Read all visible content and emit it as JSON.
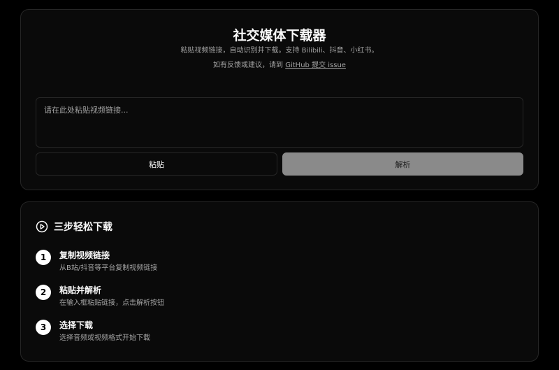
{
  "header": {
    "title": "社交媒体下载器",
    "subtitle": "粘贴视频链接，自动识别并下载。支持 Bilibili、抖音、小红书。",
    "feedback_prefix": "如有反馈或建议，请到",
    "feedback_link": "GitHub 提交 issue"
  },
  "input": {
    "placeholder": "请在此处粘贴视频链接...",
    "value": ""
  },
  "buttons": {
    "paste_label": "粘贴",
    "parse_label": "解析"
  },
  "steps": {
    "title": "三步轻松下载",
    "icon": "play-circle-icon",
    "items": [
      {
        "number": "1",
        "title": "复制视频链接",
        "desc": "从B站/抖音等平台复制视频链接"
      },
      {
        "number": "2",
        "title": "粘贴并解析",
        "desc": "在输入框粘贴链接，点击解析按钮"
      },
      {
        "number": "3",
        "title": "选择下载",
        "desc": "选择音频或视频格式开始下载"
      }
    ]
  },
  "colors": {
    "background": "#000000",
    "card": "#0a0a0a",
    "border": "#262626",
    "muted_text": "#a3a3a3",
    "parse_button": "#8a8a8a"
  }
}
